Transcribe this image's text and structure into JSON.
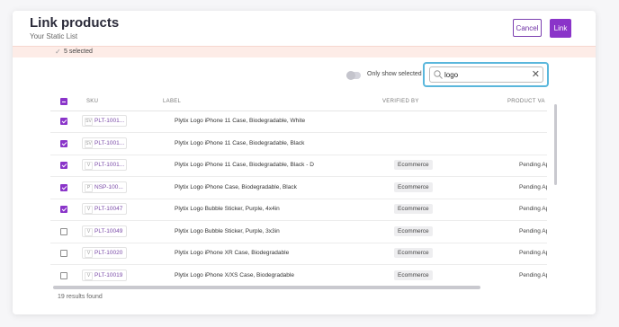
{
  "header": {
    "title": "Link products",
    "subtitle": "Your Static List",
    "cancel_label": "Cancel",
    "link_label": "Link"
  },
  "selection_bar": {
    "text": "5 selected"
  },
  "filter": {
    "toggle_label": "Only show selected",
    "toggle_on": false,
    "search_value": "logo"
  },
  "table": {
    "columns": [
      "SKU",
      "LABEL",
      "VERIFIED BY",
      "PRODUCT VA"
    ],
    "rows": [
      {
        "checked": true,
        "badge": "SV",
        "sku": "PLT-1001...",
        "label": "Plytix Logo iPhone 11 Case, Biodegradable, White",
        "verified_by": "",
        "product_va": ""
      },
      {
        "checked": true,
        "badge": "SV",
        "sku": "PLT-1001...",
        "label": "Plytix Logo iPhone 11 Case, Biodegradable, Black",
        "verified_by": "",
        "product_va": ""
      },
      {
        "checked": true,
        "badge": "V",
        "sku": "PLT-1001...",
        "label": "Plytix Logo iPhone 11 Case, Biodegradable, Black - D",
        "verified_by": "Ecommerce",
        "product_va": "Pending Appr"
      },
      {
        "checked": true,
        "badge": "P",
        "sku": "NSP-100...",
        "label": "Plytix Logo iPhone Case, Biodegradable, Black",
        "verified_by": "Ecommerce",
        "product_va": "Pending Appr"
      },
      {
        "checked": true,
        "badge": "V",
        "sku": "PLT-10047",
        "label": "Plytix Logo Bubble Sticker, Purple, 4x4in",
        "verified_by": "Ecommerce",
        "product_va": "Pending Appr"
      },
      {
        "checked": false,
        "badge": "V",
        "sku": "PLT-10049",
        "label": "Plytix Logo Bubble Sticker, Purple, 3x3in",
        "verified_by": "Ecommerce",
        "product_va": "Pending Appr"
      },
      {
        "checked": false,
        "badge": "V",
        "sku": "PLT-10020",
        "label": "Plytix Logo iPhone XR Case, Biodegradable",
        "verified_by": "Ecommerce",
        "product_va": "Pending Appr"
      },
      {
        "checked": false,
        "badge": "V",
        "sku": "PLT-10019",
        "label": "Plytix Logo iPhone X/XS Case, Biodegradable",
        "verified_by": "Ecommerce",
        "product_va": "Pending Appr"
      }
    ]
  },
  "footer": {
    "results": "19 results found"
  },
  "colors": {
    "accent": "#8a34c9",
    "search_focus": "#5ab7dc",
    "selection_bar_bg": "#fdece7"
  }
}
